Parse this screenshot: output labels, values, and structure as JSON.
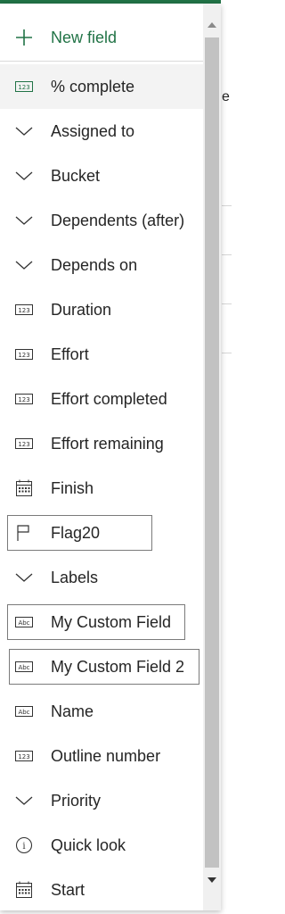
{
  "menu": {
    "new_field": {
      "label": "New field",
      "icon": "plus-icon"
    },
    "items": [
      {
        "label": "% complete",
        "icon": "number-icon",
        "selected": true
      },
      {
        "label": "Assigned to",
        "icon": "chevron-down-icon"
      },
      {
        "label": "Bucket",
        "icon": "chevron-down-icon"
      },
      {
        "label": "Dependents (after)",
        "icon": "chevron-down-icon"
      },
      {
        "label": "Depends on",
        "icon": "chevron-down-icon"
      },
      {
        "label": "Duration",
        "icon": "number-icon"
      },
      {
        "label": "Effort",
        "icon": "number-icon"
      },
      {
        "label": "Effort completed",
        "icon": "number-icon"
      },
      {
        "label": "Effort remaining",
        "icon": "number-icon"
      },
      {
        "label": "Finish",
        "icon": "calendar-icon"
      },
      {
        "label": "Flag20",
        "icon": "flag-icon",
        "boxed": true
      },
      {
        "label": "Labels",
        "icon": "chevron-down-icon"
      },
      {
        "label": "My Custom Field",
        "icon": "text-field-icon",
        "boxed": true
      },
      {
        "label": "My Custom Field 2",
        "icon": "text-field-icon",
        "boxed": true
      },
      {
        "label": "Name",
        "icon": "text-field-icon"
      },
      {
        "label": "Outline number",
        "icon": "number-icon"
      },
      {
        "label": "Priority",
        "icon": "chevron-down-icon"
      },
      {
        "label": "Quick look",
        "icon": "info-icon"
      },
      {
        "label": "Start",
        "icon": "calendar-icon"
      }
    ],
    "icon_text": {
      "number": "123",
      "text_field": "Abc",
      "info": "i"
    }
  },
  "background": {
    "left_glyph": ":",
    "right_glyph": "e"
  },
  "colors": {
    "accent": "#217346",
    "selected_bg": "#f3f3f3",
    "scrollbar_track": "#f0f0f0",
    "scrollbar_thumb": "#c2c2c2"
  }
}
